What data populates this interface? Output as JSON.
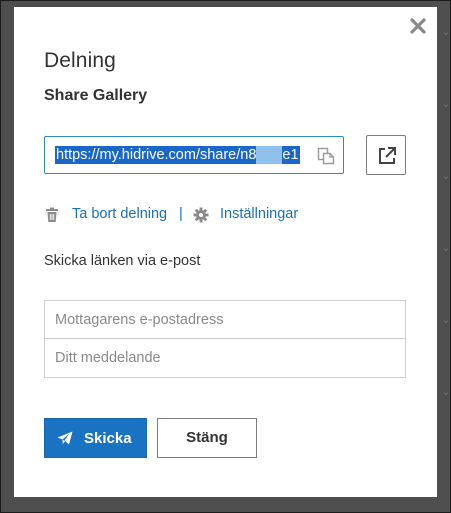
{
  "dialog": {
    "title": "Delning",
    "subtitle": "Share Gallery",
    "close_icon": "close-icon"
  },
  "share_link": {
    "url_start": "https://my.hidrive.com/share/n8",
    "url_end": "e1",
    "copy_icon": "copy-icon",
    "open_icon": "external-link-icon"
  },
  "actions": {
    "remove_label": "Ta bort delning",
    "separator": "|",
    "settings_label": "Inställningar",
    "remove_icon": "trash-icon",
    "settings_icon": "gear-icon"
  },
  "email": {
    "section_label": "Skicka länken via e-post",
    "recipient_placeholder": "Mottagarens e-postadress",
    "message_placeholder": "Ditt meddelande"
  },
  "buttons": {
    "send_label": "Skicka",
    "send_icon": "paper-plane-icon",
    "close_label": "Stäng"
  },
  "colors": {
    "accent": "#1a73c2",
    "link": "#1a6fb8",
    "selection": "#1a67c8"
  }
}
